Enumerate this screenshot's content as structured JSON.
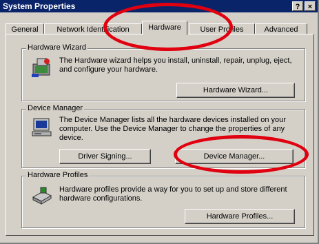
{
  "window": {
    "title": "System Properties",
    "help_label": "?",
    "close_label": "×"
  },
  "tabs": [
    {
      "label": "General"
    },
    {
      "label": "Network Identification"
    },
    {
      "label": "Hardware"
    },
    {
      "label": "User Profiles"
    },
    {
      "label": "Advanced"
    }
  ],
  "hardware_wizard": {
    "legend": "Hardware Wizard",
    "description": "The Hardware wizard helps you install, uninstall, repair, unplug, eject, and configure your hardware.",
    "button_label": "Hardware Wizard..."
  },
  "device_manager": {
    "legend": "Device Manager",
    "description": "The Device Manager lists all the hardware devices installed on your computer. Use the Device Manager to change the properties of any device.",
    "driver_signing_label": "Driver Signing...",
    "button_label": "Device Manager..."
  },
  "hardware_profiles": {
    "legend": "Hardware Profiles",
    "description": "Hardware profiles provide a way for you to set up and store different hardware configurations.",
    "button_label": "Hardware Profiles..."
  },
  "colors": {
    "highlight_circle": "#e0000f",
    "titlebar": "#0a246a",
    "face": "#d4d0c8"
  }
}
